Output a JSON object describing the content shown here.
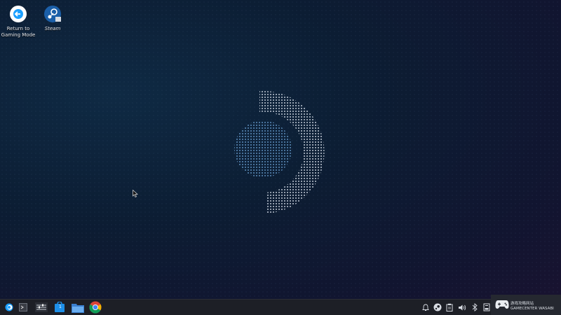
{
  "desktop": {
    "icons": [
      {
        "label_line1": "Return to",
        "label_line2": "Gaming Mode",
        "icon": "return-arrow-icon"
      },
      {
        "label": "Steam",
        "icon": "steam-icon"
      }
    ]
  },
  "wallpaper": {
    "logo": "steam-deck-logo"
  },
  "taskbar": {
    "launcher_icon": "steam-deck-launcher-icon",
    "apps": [
      {
        "name": "konsole-icon"
      },
      {
        "name": "system-settings-icon"
      },
      {
        "name": "discover-store-icon",
        "badge": "1"
      },
      {
        "name": "file-manager-icon"
      },
      {
        "name": "chrome-icon"
      }
    ],
    "tray": [
      "notifications-icon",
      "steam-tray-icon",
      "clipboard-icon",
      "volume-icon",
      "bluetooth-icon",
      "storage-icon"
    ]
  },
  "overlay": {
    "line1": "GAMECENTER WASABI",
    "line2": "游戏攻略网站"
  },
  "colors": {
    "accent": "#1a9fff",
    "taskbar": "#1d1f26"
  }
}
